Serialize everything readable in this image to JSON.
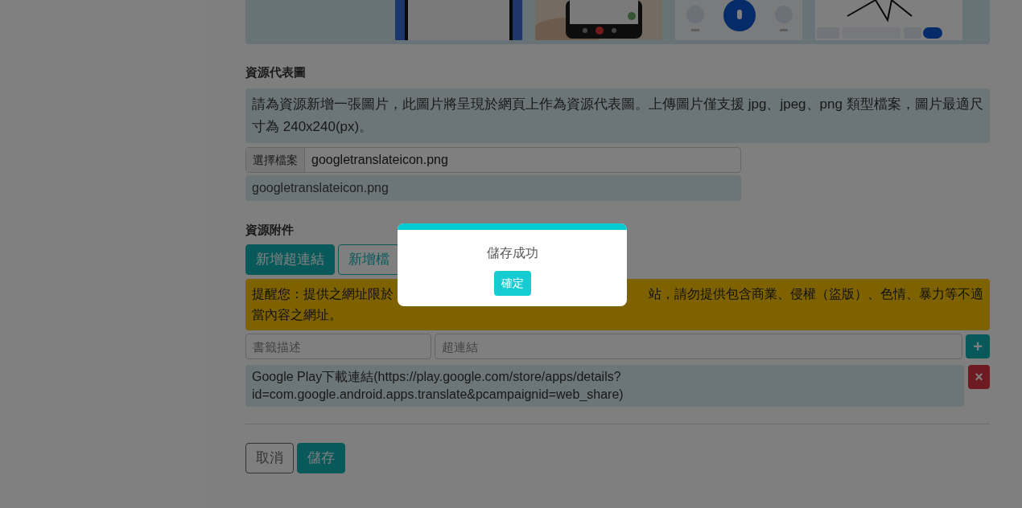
{
  "cover": {
    "heading": "資源代表圖",
    "note": "請為資源新增一張圖片，此圖片將呈現於網頁上作為資源代表圖。上傳圖片僅支援 jpg、jpeg、png 類型檔案，圖片最適尺寸為 240x240(px)。",
    "choose_label": "選擇檔案",
    "file_name": "googletranslateicon.png",
    "uploaded": "googletranslateicon.png"
  },
  "attachments": {
    "heading": "資源附件",
    "tabs": [
      {
        "label": "新增超連結",
        "selected": true
      },
      {
        "label": "新增檔",
        "selected": false
      }
    ],
    "warning_lines": [
      [
        "提醒您：提供之網址限於",
        "站，請勿提供包含商業、侵權（盜版）、色情、暴力等不適"
      ],
      [
        "當內容之網址。"
      ]
    ],
    "desc_placeholder": "書籤描述",
    "link_placeholder": "超連結",
    "add": "+",
    "links": [
      {
        "text": "Google Play下載連結(https://play.google.com/store/apps/details?id=com.google.android.apps.translate&pcampaignid=web_share)",
        "remove": "×"
      }
    ]
  },
  "buttons": [
    {
      "label": "取消",
      "kind": "outline"
    },
    {
      "label": "儲存",
      "kind": "primary"
    }
  ],
  "modal": {
    "message": "儲存成功",
    "button": "確定"
  }
}
